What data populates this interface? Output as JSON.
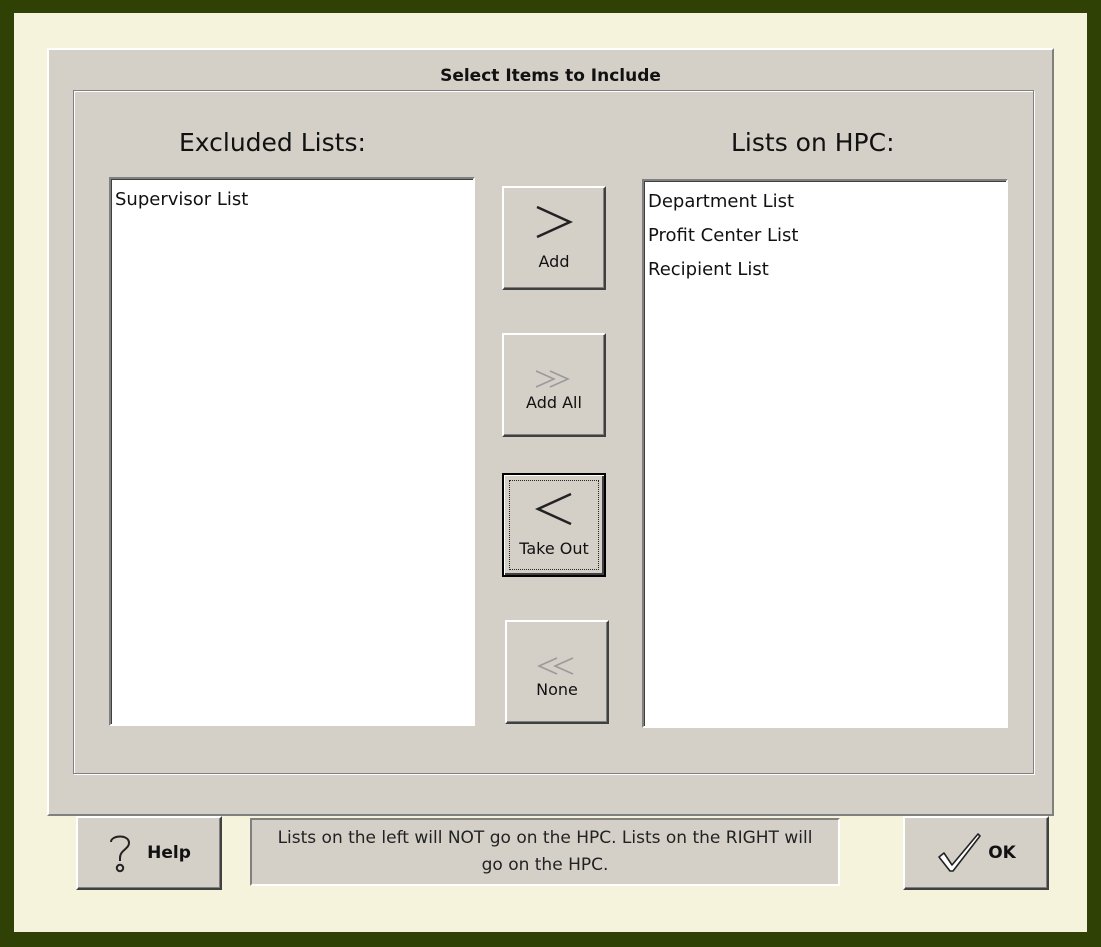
{
  "group": {
    "title": "Select Items to Include"
  },
  "excluded": {
    "header": "Excluded Lists:",
    "items": [
      "Supervisor List"
    ]
  },
  "included": {
    "header": "Lists on HPC:",
    "items": [
      "Department List",
      "Profit Center List",
      "Recipient List"
    ]
  },
  "buttons": {
    "add": {
      "label": "Add",
      "icon": "single-chevron-right-icon",
      "enabled": true
    },
    "add_all": {
      "label": "Add All",
      "icon": "double-chevron-right-icon",
      "enabled": false
    },
    "take_out": {
      "label": "Take Out",
      "icon": "single-chevron-left-icon",
      "enabled": true,
      "focused": true
    },
    "none": {
      "label": "None",
      "icon": "double-chevron-left-icon",
      "enabled": false
    }
  },
  "footer": {
    "help_label": "Help",
    "help_icon": "question-mark-icon",
    "status": "Lists on the left will NOT go on the HPC.   Lists on the RIGHT will go on the HPC.",
    "ok_label": "OK",
    "ok_icon": "checkmark-icon"
  },
  "colors": {
    "frame": "#2f4105",
    "inner_background": "#f5f3dc",
    "panel": "#d4d0c8",
    "list_background": "#ffffff"
  }
}
